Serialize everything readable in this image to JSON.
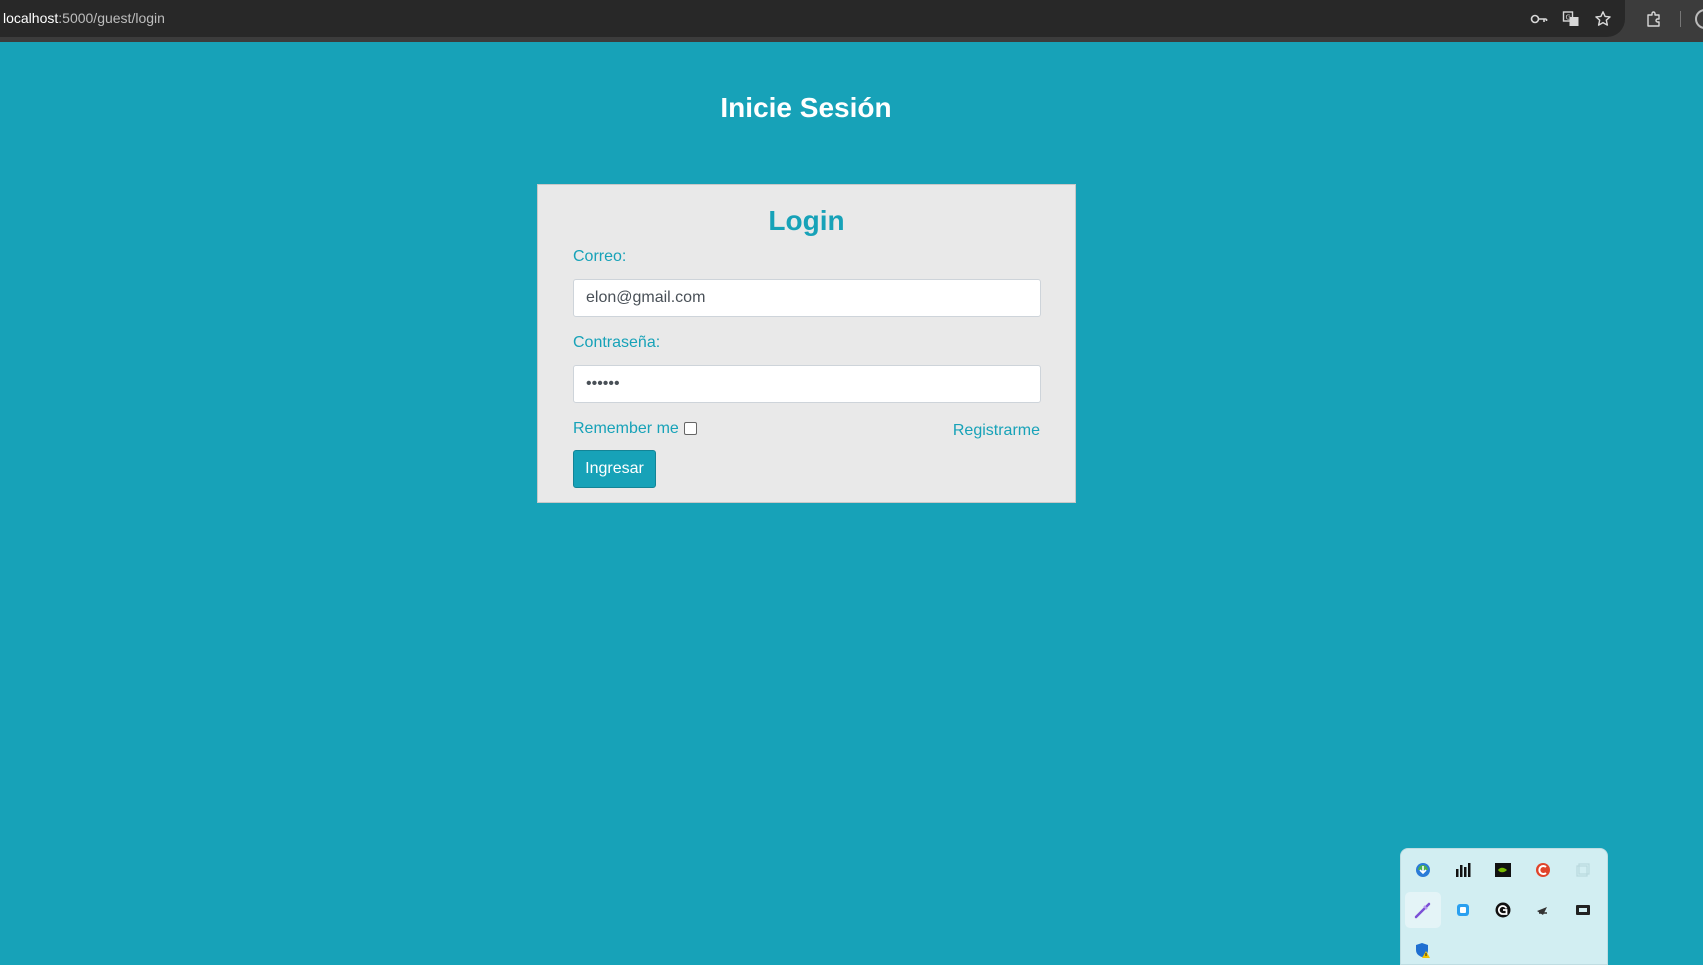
{
  "browser": {
    "url_host": "localhost",
    "url_path": ":5000/guest/login",
    "icons": [
      "key-icon",
      "translate-icon",
      "star-icon",
      "extensions-icon"
    ]
  },
  "page": {
    "heading": "Inicie Sesión"
  },
  "login_card": {
    "title": "Login",
    "email_label": "Correo:",
    "email_value": "elon@gmail.com",
    "password_label": "Contraseña:",
    "password_value": "••••••",
    "remember_label": "Remember me",
    "remember_checked": false,
    "register_link": "Registrarme",
    "submit_label": "Ingresar"
  },
  "tray": {
    "icons": [
      "internet-download-manager-icon",
      "performance-monitor-icon",
      "nvidia-icon",
      "ccleaner-icon",
      "window-copy-icon",
      "pen-feather-icon",
      "blue-square-app-icon",
      "g-hub-icon",
      "steam-icon",
      "film-reel-icon",
      "security-shield-warning-icon"
    ]
  }
}
